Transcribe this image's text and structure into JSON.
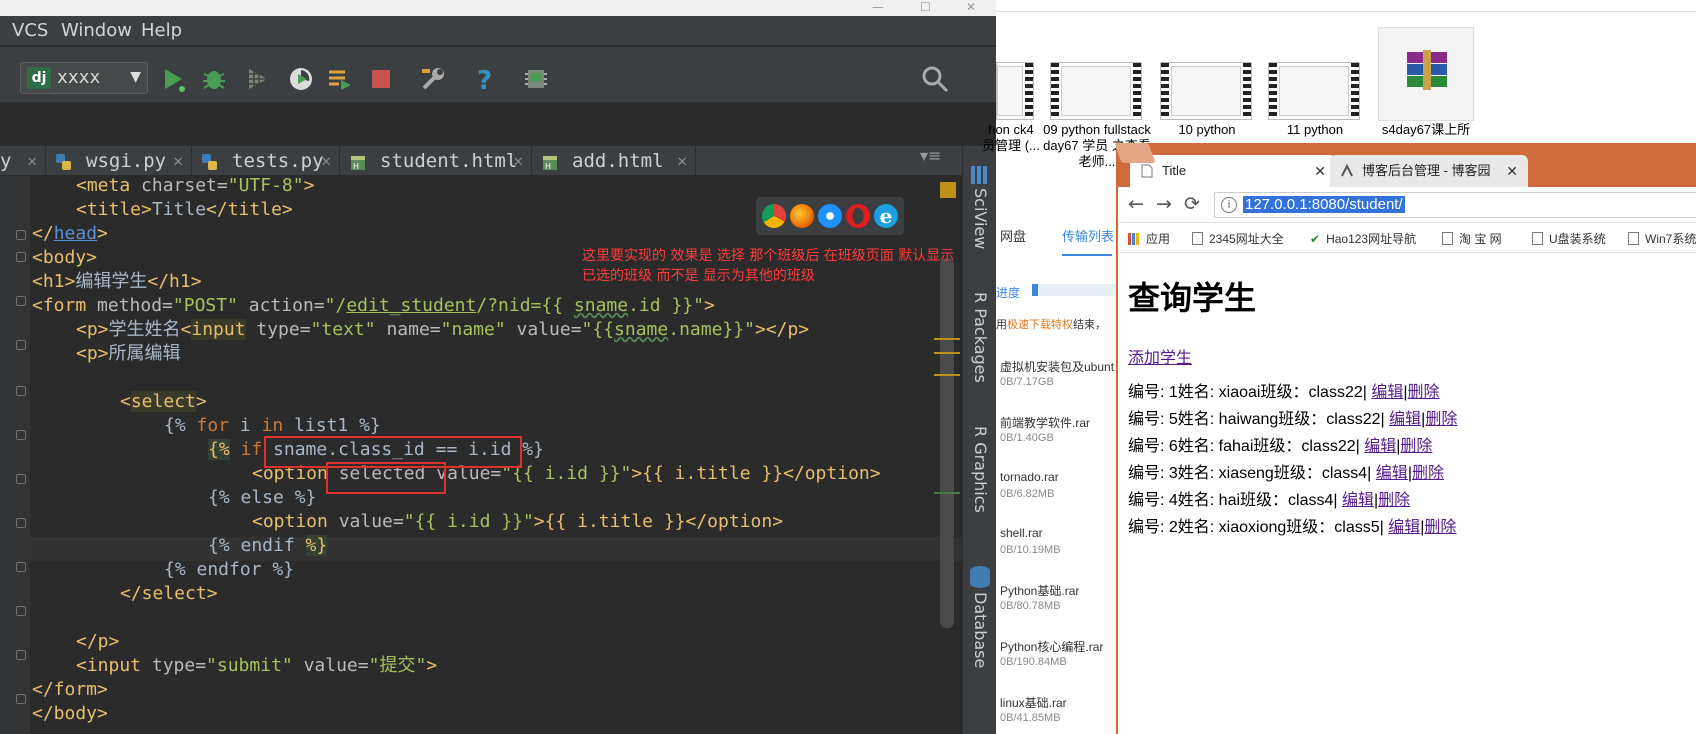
{
  "ide": {
    "menu": [
      "VCS",
      "Window",
      "Help"
    ],
    "window_controls": [
      "—",
      "☐",
      "✕"
    ],
    "run_config": {
      "icon_text": "dj",
      "label": "xxxx"
    },
    "toolbar_icons": [
      "run-icon",
      "debug-icon",
      "coverage-icon",
      "profile-icon",
      "concurrency-icon",
      "stop-icon",
      "settings-wrench-icon",
      "help-icon",
      "sdk-icon",
      "search-icon"
    ],
    "tabs": [
      {
        "label": "wsgi.py",
        "close": "✕"
      },
      {
        "label": "tests.py",
        "close": "✕"
      },
      {
        "label": "student.html",
        "close": "✕"
      },
      {
        "label": "add.html",
        "close": "✕"
      }
    ],
    "tabs_overflow": "▾≡",
    "partial_tab": {
      "label": "y",
      "close": "✕"
    },
    "side_tool_windows": [
      "SciView",
      "R Packages",
      "R Graphics",
      "Database"
    ],
    "code": {
      "l1": {
        "a": "<meta ",
        "b": "charset=",
        "c": "\"UTF-8\"",
        "d": ">"
      },
      "l2": {
        "a": "<title>",
        "b": "Title",
        "c": "</title>"
      },
      "l3": {
        "a": "</",
        "b": "head",
        "c": ">"
      },
      "l4": {
        "a": "<body>"
      },
      "l5": {
        "a": "<h1>",
        "b": "编辑学生",
        "c": "</h1>"
      },
      "l6": {
        "a": "<form ",
        "b": "method=",
        "c": "\"POST\"",
        "d": " action=",
        "e": "\"/",
        "f": "edit_student",
        "g": "/?nid={{ ",
        "h": "sname",
        "i": ".id }}\"",
        "j": ">"
      },
      "l7": {
        "a": "<p>",
        "b": "学生姓名",
        "c": "<",
        "d": "input",
        "e": " type=",
        "f": "\"text\"",
        "g": " name=",
        "h": "\"name\"",
        "i": " value=",
        "j": "\"{{",
        "k": "sname",
        "l": ".name}}\"",
        "m": "></p>"
      },
      "l8": {
        "a": "<p>",
        "b": "所属编辑"
      },
      "l9": {
        "a": "<",
        "b": "select",
        "c": ">"
      },
      "l10": {
        "a": "{% ",
        "b": "for ",
        "c": "i ",
        "d": "in ",
        "e": "list1 %}"
      },
      "l11": {
        "a": "{%",
        "b": " if ",
        "c": "sname.class_id == i.id ",
        "d": "%}"
      },
      "l12": {
        "a": "<option ",
        "b": "selected ",
        "c": "value=",
        "d": "\"{{ i.id }}\"",
        "e": ">{{ i.title }}",
        "f": "</option>"
      },
      "l13": {
        "a": "{% else %}"
      },
      "l14": {
        "a": "<option ",
        "b": "value=",
        "c": "\"{{ i.id }}\"",
        "d": ">{{ i.title }}",
        "e": "</option>"
      },
      "l15": {
        "a": "{% endif ",
        "b": "%}"
      },
      "l16": {
        "a": "{% endfor %}"
      },
      "l17": {
        "a": "</select>"
      },
      "l18": {
        "a": "</p>"
      },
      "l19": {
        "a": "<input ",
        "b": "type=",
        "c": "\"submit\"",
        "d": " value=",
        "e": "\"提交\"",
        "f": ">"
      },
      "l20": {
        "a": "</form>"
      },
      "l21": {
        "a": "</body>"
      }
    },
    "annotation_line1": "这里要实现的 效果是 选择 那个班级后 在班级页面 默认显示",
    "annotation_line2": "已选的班级 而不是 显示为其他的班级"
  },
  "desktop": {
    "thumbnails": [
      {
        "caption": "hon ck4 员管理 (..."
      },
      {
        "caption": "09 python fullstack day67 学员 之查看老师..."
      },
      {
        "caption": "10 python"
      },
      {
        "caption": "11 python"
      },
      {
        "caption": "s4day67课上所"
      }
    ],
    "baidu": {
      "tab_left": "网盘",
      "tab_active": "传输列表",
      "progress_label": "进度",
      "notice_prefix": "用",
      "notice_link": "极速下载特权",
      "notice_suffix": "结束，",
      "files": [
        {
          "name": "虚拟机安装包及ubunt",
          "size": "0B/7.17GB"
        },
        {
          "name": "前端教学软件.rar",
          "size": "0B/1.40GB"
        },
        {
          "name": "tornado.rar",
          "size": "0B/6.82MB"
        },
        {
          "name": "shell.rar",
          "size": "0B/10.19MB"
        },
        {
          "name": "Python基础.rar",
          "size": "0B/80.78MB"
        },
        {
          "name": "Python核心编程.rar",
          "size": "0B/190.84MB"
        },
        {
          "name": "linux基础.rar",
          "size": "0B/41.85MB"
        }
      ]
    }
  },
  "chrome": {
    "tab_active": {
      "title": "Title",
      "close": "✕"
    },
    "tab_2": {
      "title": "博客后台管理 - 博客园",
      "close": "✕"
    },
    "nav": {
      "back": "←",
      "forward": "→",
      "reload": "⟳",
      "info": "i"
    },
    "url": "127.0.0.1:8080/student/",
    "bookmarks": [
      "应用",
      "2345网址大全",
      "Hao123网址导航",
      "淘 宝 网",
      "U盘装系统",
      "Win7系统"
    ],
    "page": {
      "heading": "查询学生",
      "add_link": "添加学生",
      "edit_label": "编辑",
      "delete_label": "删除",
      "students": [
        {
          "text": "编号: 1姓名: xiaoai班级：class22|"
        },
        {
          "text": "编号: 5姓名: haiwang班级：class22|"
        },
        {
          "text": "编号: 6姓名: fahai班级：class22|"
        },
        {
          "text": "编号: 3姓名: xiaseng班级：class4|"
        },
        {
          "text": "编号: 4姓名: hai班级：class4|"
        },
        {
          "text": "编号: 2姓名: xiaoxiong班级：class5|"
        }
      ]
    }
  },
  "colors": {
    "ide_bg": "#2b2b2b",
    "chrome_frame": "#d06a3a",
    "annotation": "#ff3b3b",
    "url_highlight": "#3372d8"
  }
}
